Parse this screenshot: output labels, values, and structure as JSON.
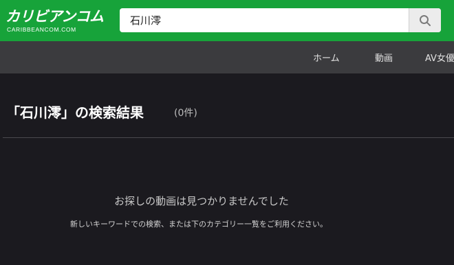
{
  "header": {
    "logo_text": "カリビアンコム",
    "logo_subtext": "CARIBBEANCOM.COM",
    "search": {
      "value": "石川澪",
      "placeholder": ""
    },
    "search_button_icon": "search-icon"
  },
  "nav": {
    "items": [
      {
        "label": "ホーム"
      },
      {
        "label": "動画"
      },
      {
        "label": "AV女優"
      }
    ]
  },
  "results": {
    "title": "「石川澪」の検索結果",
    "count": "(0件)"
  },
  "empty_state": {
    "message": "お探しの動画は見つかりませんでした",
    "hint": "新しいキーワードでの検索、または下のカテゴリー一覧をご利用ください。"
  },
  "colors": {
    "brand_green": "#17a33a",
    "nav_bg": "#3b3b3e",
    "page_bg": "#1b1a1f"
  }
}
